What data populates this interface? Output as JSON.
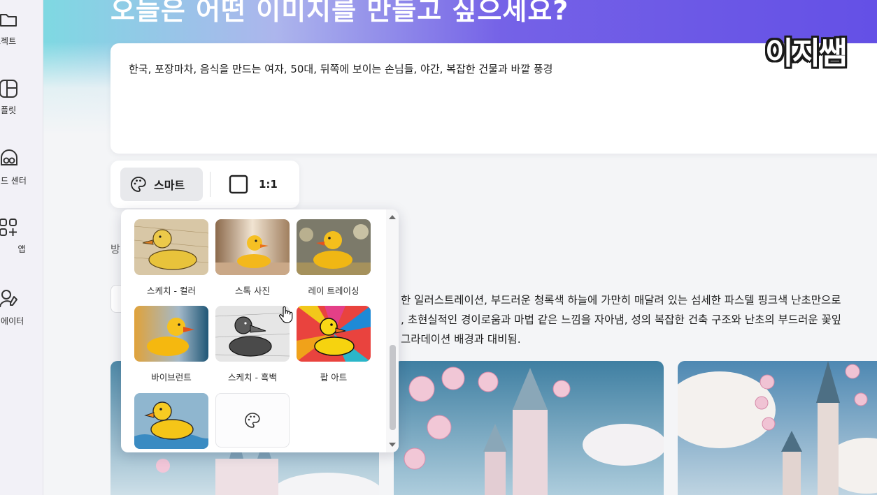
{
  "sidebar": {
    "items": [
      {
        "label": "로젝트",
        "icon": "folder-icon"
      },
      {
        "label": "템플릿",
        "icon": "template-icon"
      },
      {
        "label": "랜드 센터",
        "icon": "brand-center-icon"
      },
      {
        "label": "앱",
        "icon": "apps-icon"
      },
      {
        "label": "리에이터",
        "icon": "creator-icon"
      }
    ]
  },
  "header": {
    "title": "오늘은 어떤 이미지를 만들고 싶으세요?",
    "watermark": "이지쌤"
  },
  "prompt": {
    "value": "한국, 포장마차, 음식을 만드는 여자, 50대, 뒤쪽에 보이는 손님들, 야간, 복잡한 건물과 바깥 풍경"
  },
  "toolbar": {
    "style_label": "스마트",
    "ratio_label": "1:1"
  },
  "background": {
    "side_label": "방",
    "description_lines": [
      "한 일러스트레이션, 부드러운 청록색 하늘에 가만히 매달려 있는 섬세한 파스텔 핑크색 난초만으로",
      ", 초현실적인 경이로움과 마법 같은 느낌을 자아냄, 성의 복잡한 건축 구조와 난초의 부드러운 꽃잎",
      "그라데이션 배경과 대비됨."
    ]
  },
  "styles": {
    "items": [
      {
        "label": "스케치 - 컬러"
      },
      {
        "label": "스톡 사진"
      },
      {
        "label": "레이 트레이싱"
      },
      {
        "label": "바이브런트"
      },
      {
        "label": "스케치 - 흑백"
      },
      {
        "label": "팝 아트"
      },
      {
        "label": ""
      }
    ]
  },
  "colors": {
    "accent": "#6a55e6",
    "duck_yellow": "#f5c518"
  }
}
